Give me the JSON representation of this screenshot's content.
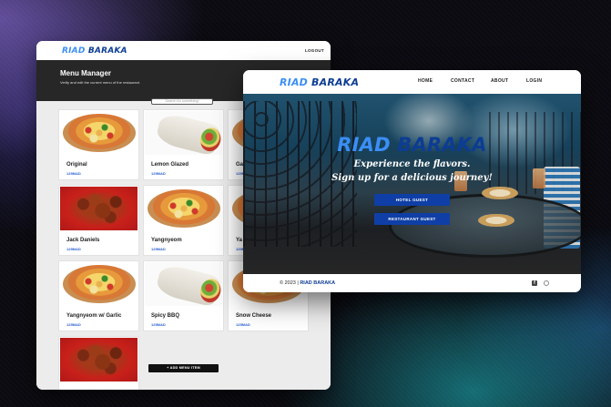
{
  "brand": {
    "riad": "RIAD",
    "baraka": "BARAKA"
  },
  "menu_manager": {
    "logout": "LOGOUT",
    "title": "Menu Manager",
    "subtitle": "Verify and edit the current menu of the restaurant.",
    "search_placeholder": "Search for something!",
    "items": [
      {
        "name": "Original",
        "price": "125MAD",
        "image": "pizza"
      },
      {
        "name": "Lemon Glazed",
        "price": "125MAD",
        "image": "wrap"
      },
      {
        "name": "Ga",
        "price": "125MAD",
        "image": "pizza"
      },
      {
        "name": "Jack Daniels",
        "price": "125MAD",
        "image": "chicken"
      },
      {
        "name": "Yangnyeom",
        "price": "125MAD",
        "image": "pizza"
      },
      {
        "name": "Ya",
        "price": "125MAD",
        "image": "pizza"
      },
      {
        "name": "Yangnyeom w/ Garlic",
        "price": "125MAD",
        "image": "pizza"
      },
      {
        "name": "Spicy BBQ",
        "price": "125MAD",
        "image": "wrap"
      },
      {
        "name": "Snow Cheese",
        "price": "125MAD",
        "image": "pizza"
      },
      {
        "name": "",
        "price": "",
        "image": "chicken"
      }
    ],
    "add_button": "+ ADD MENU ITEM"
  },
  "landing": {
    "nav": {
      "home": "HOME",
      "contact": "CONTACT",
      "about": "ABOUT",
      "login": "LOGIN"
    },
    "hero_line1": "Experience the flavors.",
    "hero_line2": "Sign up for a delicious journey!",
    "hotel_guest": "HOTEL GUEST",
    "restaurant_guest": "RESTAURANT GUEST",
    "footer_prefix": "© 2023 |",
    "footer_brand": "RIAD BARAKA",
    "social_icons": [
      "facebook-icon",
      "instagram-icon"
    ]
  }
}
